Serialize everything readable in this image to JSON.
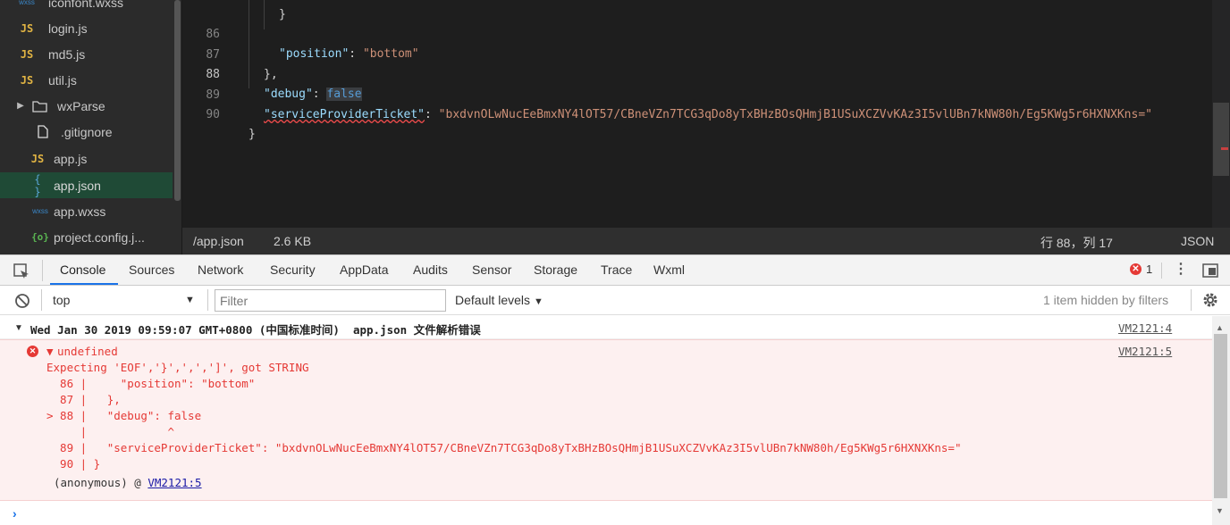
{
  "sidebar": {
    "items": [
      {
        "icon": "wxss",
        "label": "iconfont.wxss"
      },
      {
        "icon": "JS",
        "label": "login.js"
      },
      {
        "icon": "JS",
        "label": "md5.js"
      },
      {
        "icon": "JS",
        "label": "util.js"
      },
      {
        "icon": "folder",
        "label": "wxParse"
      },
      {
        "icon": "file",
        "label": ".gitignore"
      },
      {
        "icon": "JS",
        "label": "app.js"
      },
      {
        "icon": "{ }",
        "label": "app.json"
      },
      {
        "icon": "wxss",
        "label": "app.wxss"
      },
      {
        "icon": "{o}",
        "label": "project.config.j..."
      }
    ]
  },
  "editor": {
    "lines": [
      {
        "num": "86",
        "key": "\"position\"",
        "value": "\"bottom\""
      },
      {
        "num": "87",
        "text": "},"
      },
      {
        "num": "88",
        "key": "\"debug\"",
        "value": "false"
      },
      {
        "num": "89",
        "key": "\"serviceProviderTicket\"",
        "value": "\"bxdvnOLwNucEeBmxNY4lOT57/CBneVZn7TCG3qDo8yTxBHzBOsQHmjB1USuXCZVvKAz3I5vlUBn7kNW80h/Eg5KWg5r6HXNXKns=\""
      },
      {
        "num": "90",
        "text": "}"
      }
    ]
  },
  "statusbar": {
    "path": "/app.json",
    "size": "2.6 KB",
    "position": "行 88，列 17",
    "language": "JSON"
  },
  "devtools": {
    "tabs": [
      "Console",
      "Sources",
      "Network",
      "Security",
      "AppData",
      "Audits",
      "Sensor",
      "Storage",
      "Trace",
      "Wxml"
    ],
    "error_count": "1"
  },
  "toolbar": {
    "context": "top",
    "filter_placeholder": "Filter",
    "levels": "Default levels",
    "hidden_note": "1 item hidden by filters"
  },
  "console": {
    "group_header": "Wed Jan 30 2019 09:59:07 GMT+0800 (中国标准时间)  app.json 文件解析错误",
    "group_source": "VM2121:4",
    "error_source": "VM2121:5",
    "error_lines": [
      "undefined",
      "Expecting 'EOF','}',',',']', got STRING",
      "  86 |     \"position\": \"bottom\"",
      "  87 |   },",
      "> 88 |   \"debug\": false",
      "     |            ^",
      "  89 |   \"serviceProviderTicket\": \"bxdvnOLwNucEeBmxNY4lOT57/CBneVZn7TCG3qDo8yTxBHzBOsQHmjB1USuXCZVvKAz3I5vlUBn7kNW80h/Eg5KWg5r6HXNXKns=\"",
      "  90 | }"
    ],
    "stack_text": "(anonymous) @ ",
    "stack_link": "VM2121:5"
  }
}
